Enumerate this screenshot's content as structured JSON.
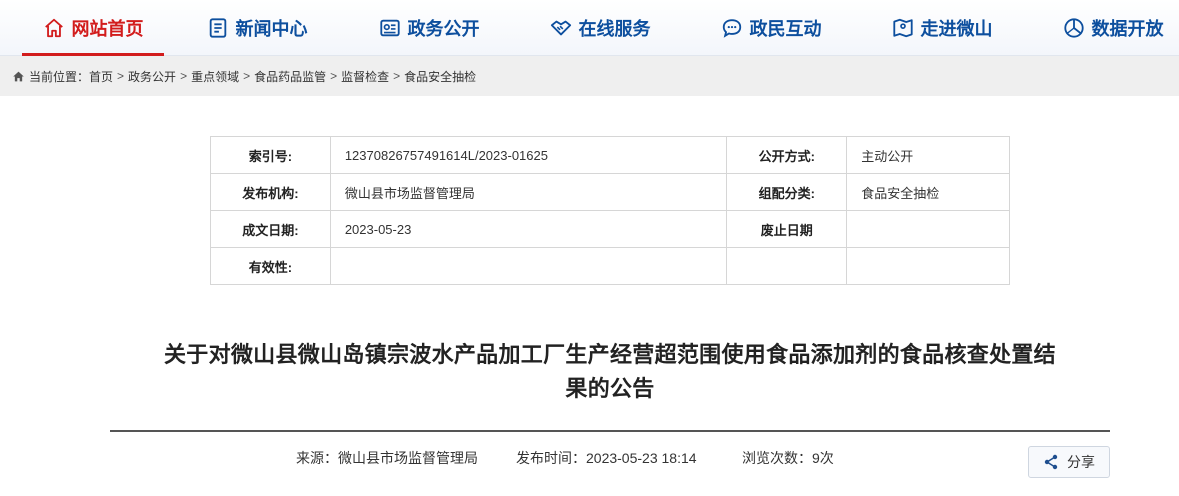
{
  "nav": {
    "items": [
      {
        "label": "网站首页",
        "icon": "home-icon",
        "active": true
      },
      {
        "label": "新闻中心",
        "icon": "news-icon"
      },
      {
        "label": "政务公开",
        "icon": "gov-open-icon"
      },
      {
        "label": "在线服务",
        "icon": "handshake-icon"
      },
      {
        "label": "政民互动",
        "icon": "chat-icon"
      },
      {
        "label": "走进微山",
        "icon": "map-icon"
      },
      {
        "label": "数据开放",
        "icon": "data-icon"
      }
    ]
  },
  "breadcrumb": {
    "prefix": "当前位置：",
    "items": [
      "首页",
      "政务公开",
      "重点领域",
      "食品药品监管",
      "监督检查",
      "食品安全抽检"
    ],
    "separator": ">"
  },
  "meta": {
    "index_label": "索引号:",
    "index_value": "12370826757491614L/2023-01625",
    "public_mode_label": "公开方式:",
    "public_mode_value": "主动公开",
    "publisher_label": "发布机构:",
    "publisher_value": "微山县市场监督管理局",
    "category_label": "组配分类:",
    "category_value": "食品安全抽检",
    "date_label": "成文日期:",
    "date_value": "2023-05-23",
    "expire_label": "废止日期",
    "expire_value": "",
    "validity_label": "有效性:",
    "validity_value": ""
  },
  "article": {
    "title_line1": "关于对微山县微山岛镇宗波水产品加工厂生产经营超范围使用食品添加剂的食品核查处置结",
    "title_line2": "果的公告",
    "source": "来源：微山县市场监督管理局",
    "publish_time": "发布时间：2023-05-23 18:14",
    "views": "浏览次数：9次"
  },
  "share": {
    "label": "分享",
    "icon": "share-icon"
  },
  "colors": {
    "nav_text": "#0d4f9e",
    "active": "#d21c1c"
  }
}
